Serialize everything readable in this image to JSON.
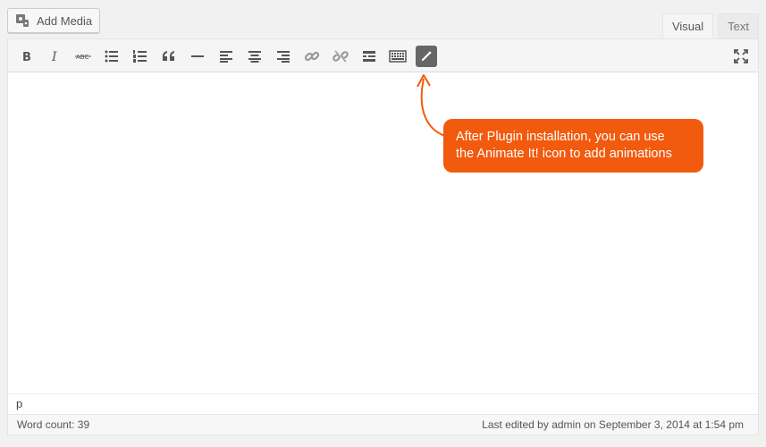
{
  "add_media": {
    "label": "Add Media",
    "icon": "media-icon"
  },
  "tabs": [
    {
      "label": "Visual",
      "active": true
    },
    {
      "label": "Text",
      "active": false
    }
  ],
  "toolbar": {
    "buttons": [
      "bold-icon",
      "italic-icon",
      "strikethrough-icon",
      "bulleted-list-icon",
      "numbered-list-icon",
      "blockquote-icon",
      "horizontal-line-icon",
      "align-left-icon",
      "align-center-icon",
      "align-right-icon",
      "link-icon",
      "unlink-icon",
      "read-more-icon",
      "toolbar-toggle-icon",
      "animate-it-icon"
    ],
    "fullscreen": "fullscreen-icon"
  },
  "path_bar": {
    "text": "p"
  },
  "status": {
    "word_count": "Word count: 39",
    "last_edited": "Last edited by admin on September 3, 2014 at 1:54 pm"
  },
  "callout": {
    "line1": "After Plugin installation, you can use",
    "line2": "the Animate It! icon to add animations",
    "color": "#f25a0e"
  }
}
